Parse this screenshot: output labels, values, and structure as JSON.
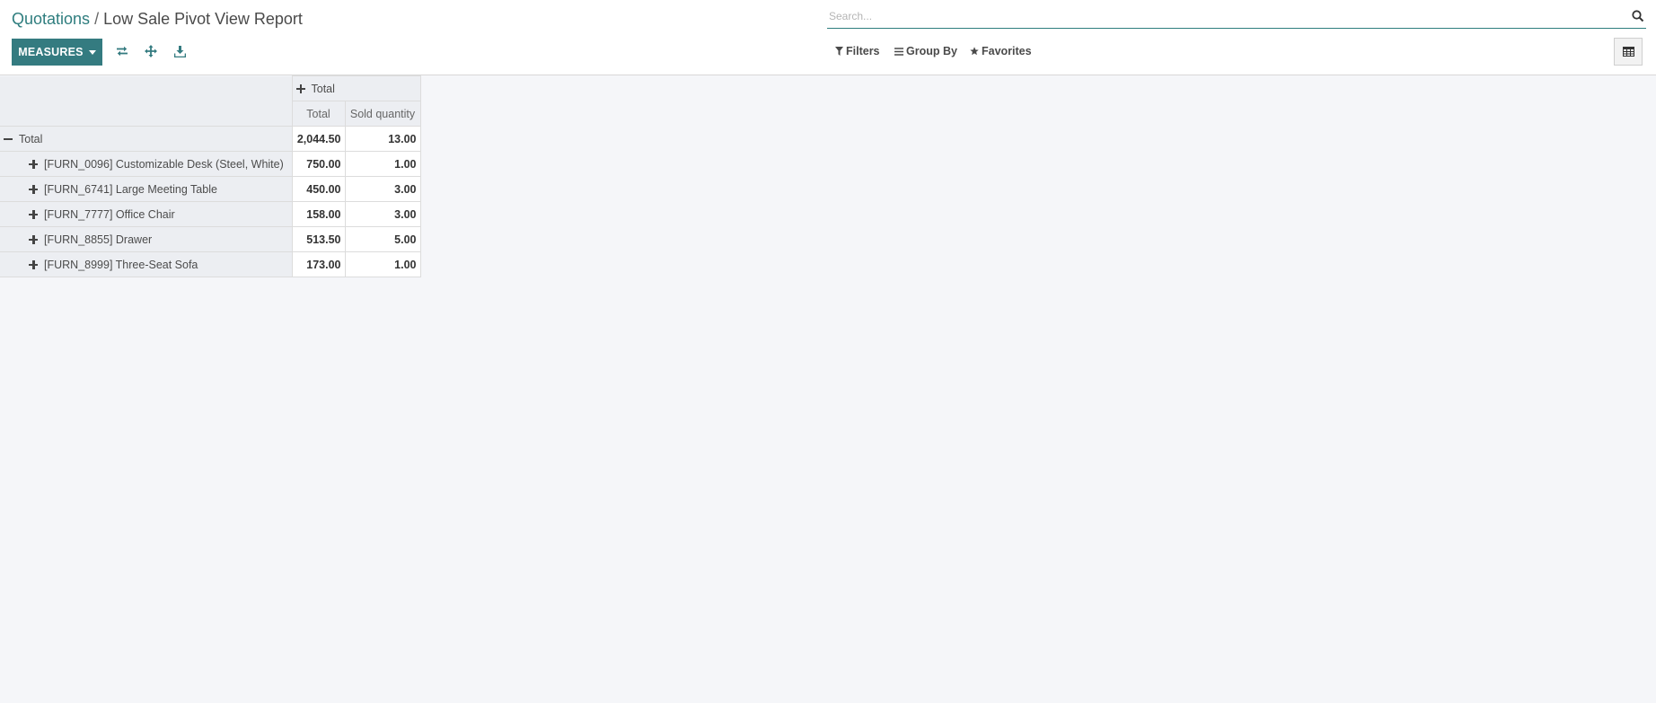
{
  "breadcrumb": {
    "parent": "Quotations",
    "separator": " / ",
    "current": "Low Sale Pivot View Report"
  },
  "toolbar": {
    "measures_label": "MEASURES"
  },
  "search": {
    "placeholder": "Search..."
  },
  "filters": {
    "filters_label": "Filters",
    "group_by_label": "Group By",
    "favorites_label": "Favorites"
  },
  "colors": {
    "accent": "#347b80",
    "link": "#2e7d7e",
    "background": "#f5f6f9"
  },
  "pivot": {
    "col_header_total": "Total",
    "measure_headers": [
      "Total",
      "Sold quantity"
    ],
    "total_row": {
      "label": "Total",
      "total": "2,044.50",
      "qty": "13.00"
    },
    "rows": [
      {
        "label": "[FURN_0096] Customizable Desk (Steel, White)",
        "total": "750.00",
        "qty": "1.00"
      },
      {
        "label": "[FURN_6741] Large Meeting Table",
        "total": "450.00",
        "qty": "3.00"
      },
      {
        "label": "[FURN_7777] Office Chair",
        "total": "158.00",
        "qty": "3.00"
      },
      {
        "label": "[FURN_8855] Drawer",
        "total": "513.50",
        "qty": "5.00"
      },
      {
        "label": "[FURN_8999] Three-Seat Sofa",
        "total": "173.00",
        "qty": "1.00"
      }
    ]
  }
}
